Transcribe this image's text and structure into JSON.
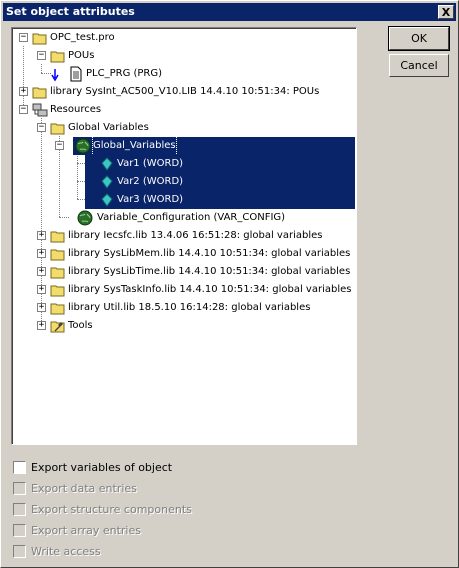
{
  "window": {
    "title": "Set object attributes",
    "close_glyph": "X"
  },
  "tree": {
    "nodes": [
      {
        "label": "OPC_test.pro",
        "icon": "folder-icon"
      },
      {
        "label": "POUs",
        "icon": "folder-icon"
      },
      {
        "label": "PLC_PRG (PRG)",
        "icon": "document-icon"
      },
      {
        "label": "library SysInt_AC500_V10.LIB 14.4.10 10:51:34: POUs",
        "icon": "folder-icon"
      },
      {
        "label": "Resources",
        "icon": "resources-icon"
      },
      {
        "label": "Global Variables",
        "icon": "folder-icon"
      },
      {
        "label": "Global_Variables",
        "icon": "globe-icon",
        "selected": true
      },
      {
        "label": "Var1 (WORD)",
        "icon": "variable-icon",
        "selected": true
      },
      {
        "label": "Var2 (WORD)",
        "icon": "variable-icon",
        "selected": true
      },
      {
        "label": "Var3 (WORD)",
        "icon": "variable-icon",
        "selected": true
      },
      {
        "label": "Variable_Configuration (VAR_CONFIG)",
        "icon": "globe-icon"
      },
      {
        "label": "library Iecsfc.lib 13.4.06 16:51:28: global variables",
        "icon": "folder-icon"
      },
      {
        "label": "library SysLibMem.lib 14.4.10 10:51:34: global variables",
        "icon": "folder-icon"
      },
      {
        "label": "library SysLibTime.lib 14.4.10 10:51:34: global variables",
        "icon": "folder-icon"
      },
      {
        "label": "library SysTaskInfo.lib 14.4.10 10:51:34: global variables",
        "icon": "folder-icon"
      },
      {
        "label": "library Util.lib 18.5.10 16:14:28: global variables",
        "icon": "folder-icon"
      },
      {
        "label": "Tools",
        "icon": "tools-icon"
      }
    ],
    "expander_plus": "+",
    "expander_minus": "−"
  },
  "buttons": {
    "ok": "OK",
    "cancel": "Cancel"
  },
  "options": [
    {
      "label": "Export variables of object",
      "checked": false,
      "enabled": true
    },
    {
      "label": "Export data entries",
      "checked": false,
      "enabled": false
    },
    {
      "label": "Export structure components",
      "checked": false,
      "enabled": false
    },
    {
      "label": "Export array entries",
      "checked": false,
      "enabled": false
    },
    {
      "label": "Write access",
      "checked": false,
      "enabled": false
    }
  ],
  "colors": {
    "selection": "#0a246a",
    "dialog_bg": "#d4d0c8",
    "folder": "#f2dc6b"
  }
}
